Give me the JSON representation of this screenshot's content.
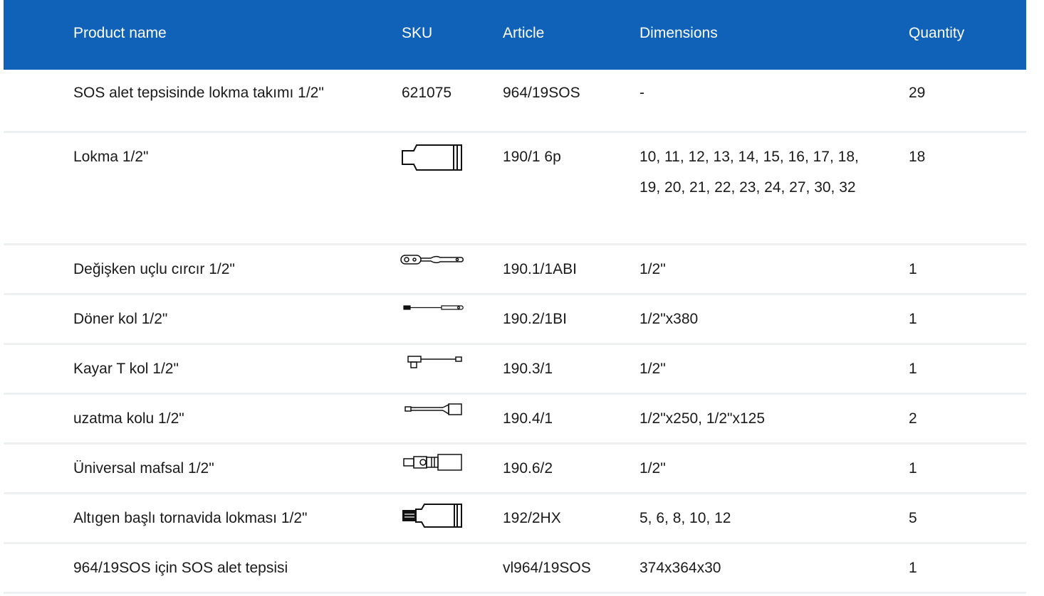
{
  "columns": {
    "product_name": "Product name",
    "sku": "SKU",
    "article": "Article",
    "dimensions": "Dimensions",
    "quantity": "Quantity"
  },
  "rows": [
    {
      "name": "SOS alet tepsisinde lokma takımı 1/2\"",
      "sku": "621075",
      "icon": "",
      "article": "964/19SOS",
      "dimensions": "-",
      "quantity": "29"
    },
    {
      "name": "Lokma 1/2\"",
      "sku": "",
      "icon": "socket-icon",
      "article": "190/1 6p",
      "dimensions": "10, 11, 12, 13, 14, 15, 16, 17, 18, 19, 20, 21, 22, 23, 24, 27, 30, 32",
      "quantity": "18"
    },
    {
      "name": "Değişken uçlu cırcır 1/2\"",
      "sku": "",
      "icon": "ratchet-icon",
      "article": "190.1/1ABI",
      "dimensions": "1/2\"",
      "quantity": "1"
    },
    {
      "name": "Döner kol 1/2\"",
      "sku": "",
      "icon": "breaker-bar-icon",
      "article": "190.2/1BI",
      "dimensions": "1/2\"x380",
      "quantity": "1"
    },
    {
      "name": "Kayar T kol 1/2\"",
      "sku": "",
      "icon": "t-handle-icon",
      "article": "190.3/1",
      "dimensions": "1/2\"",
      "quantity": "1"
    },
    {
      "name": "uzatma kolu 1/2\"",
      "sku": "",
      "icon": "extension-bar-icon",
      "article": "190.4/1",
      "dimensions": "1/2\"x250, 1/2\"x125",
      "quantity": "2"
    },
    {
      "name": "Üniversal mafsal 1/2\"",
      "sku": "",
      "icon": "universal-joint-icon",
      "article": "190.6/2",
      "dimensions": "1/2\"",
      "quantity": "1"
    },
    {
      "name": "Altıgen başlı tornavida lokması 1/2\"",
      "sku": "",
      "icon": "hex-bit-socket-icon",
      "article": "192/2HX",
      "dimensions": "5, 6, 8, 10, 12",
      "quantity": "5"
    },
    {
      "name": "964/19SOS için SOS alet tepsisi",
      "sku": "",
      "icon": "",
      "article": "vl964/19SOS",
      "dimensions": "374x364x30",
      "quantity": "1"
    }
  ],
  "colors": {
    "header_bg": "#0f62b8",
    "header_text": "#ffffff",
    "row_divider": "#eef0f2",
    "text": "#1a1a1a"
  }
}
